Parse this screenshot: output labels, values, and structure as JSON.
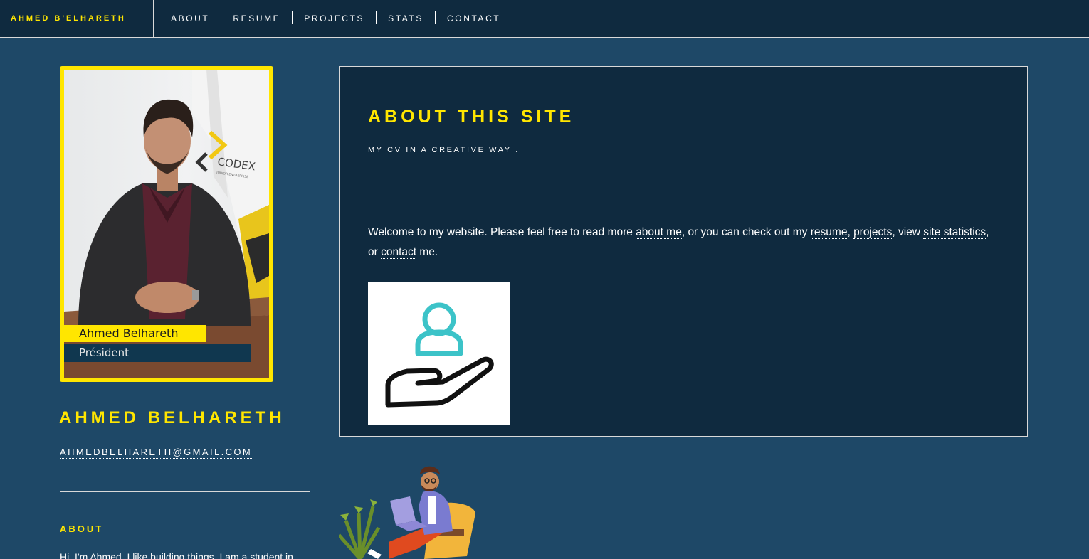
{
  "brand": "AHMED B'ELHARETH",
  "nav": {
    "items": [
      "ABOUT",
      "RESUME",
      "PROJECTS",
      "STATS",
      "CONTACT"
    ]
  },
  "profile": {
    "photo_name_tag": "Ahmed Belhareth",
    "photo_role_tag": "Président",
    "photo_banner_logo": "CODEX",
    "photo_banner_sub": "JUNIOR ENTREPRISE",
    "name": "AHMED BELHARETH",
    "email": "AHMEDBELHARETH@GMAIL.COM",
    "about_heading": "ABOUT",
    "about_text": "Hi, I'm Ahmed. I like building things. I am a student in"
  },
  "main": {
    "title": "ABOUT THIS SITE",
    "subtitle": "MY CV IN A CREATIVE WAY .",
    "welcome": {
      "p1": "Welcome to my website. Please feel free to read more ",
      "link_about": "about me",
      "p2": ", or you can check out my ",
      "link_resume": "resume",
      "p3": ", ",
      "link_projects": "projects",
      "p4": ", view ",
      "link_stats": "site statistics",
      "p5": ", or ",
      "link_contact": "contact",
      "p6": " me."
    }
  },
  "icons": {
    "welcome_image": "user-in-hand-icon",
    "illustration": "person-with-laptop-illustration"
  },
  "colors": {
    "page_bg": "#1e4867",
    "panel_bg": "#0f2a3f",
    "accent": "#ffe600",
    "text": "#ffffff"
  }
}
